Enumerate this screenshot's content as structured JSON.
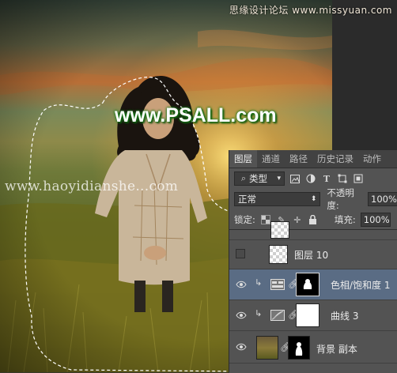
{
  "watermarks": {
    "top_right": "思缘设计论坛 www.missyuan.com",
    "center": "www.PSALL.com",
    "url": "www.haoyidianshe...com"
  },
  "layers_panel": {
    "tabs": [
      "图层",
      "通道",
      "路径",
      "历史记录",
      "动作"
    ],
    "active_tab": "图层",
    "filter_kind": "类型",
    "blend_mode": "正常",
    "opacity_label": "不透明度:",
    "opacity_value": "100%",
    "lock_label": "锁定:",
    "fill_label": "填充:",
    "fill_value": "100%",
    "layers": [
      {
        "name": "图层 10",
        "type": "pixel",
        "visible": false
      },
      {
        "name": "色相/饱和度 1",
        "type": "adjustment",
        "visible": true,
        "selected": true
      },
      {
        "name": "曲线 3",
        "type": "adjustment",
        "visible": true
      },
      {
        "name": "背景 副本",
        "type": "pixel",
        "visible": true
      }
    ]
  },
  "colors": {
    "panel_bg": "#535353",
    "selected_row": "#5a6c84",
    "watermark_green": "#1a7a1a"
  }
}
